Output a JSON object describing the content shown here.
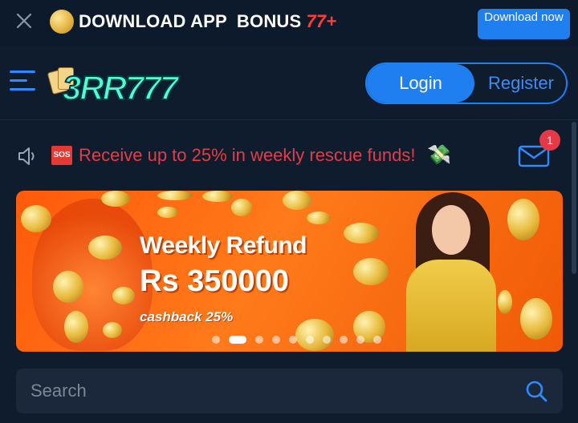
{
  "topbar": {
    "download_text": "DOWNLOAD APP",
    "bonus_text": "BONUS",
    "bonus_amount": "77+",
    "download_button": "Download now"
  },
  "header": {
    "logo_text": "3RR777",
    "login_label": "Login",
    "register_label": "Register"
  },
  "notice": {
    "badge": "SOS",
    "text": "Receive up to 25% in weekly rescue funds!",
    "emoji": "💸",
    "mail_badge_count": "1"
  },
  "banner": {
    "title": "Weekly Refund",
    "amount": "Rs 350000",
    "subtitle": "cashback 25%",
    "slide_count": 10,
    "active_slide": 2
  },
  "search": {
    "placeholder": "Search"
  },
  "colors": {
    "accent": "#1f7ff0",
    "notice": "#e23d46",
    "background": "#0f1c2e"
  }
}
